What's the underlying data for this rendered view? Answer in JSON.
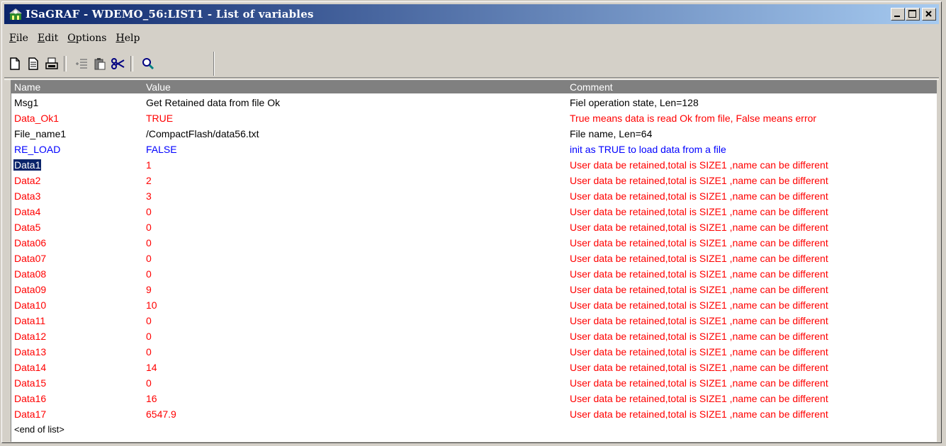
{
  "window": {
    "title": "ISaGRAF - WDEMO_56:LIST1 - List of variables"
  },
  "menu": [
    {
      "u": "F",
      "rest": "ile"
    },
    {
      "u": "E",
      "rest": "dit"
    },
    {
      "u": "O",
      "rest": "ptions"
    },
    {
      "u": "H",
      "rest": "elp"
    }
  ],
  "toolbar": {
    "icons": [
      "new-icon",
      "edit-icon",
      "print-icon",
      "insert-icon",
      "paste-icon",
      "cut-icon",
      "search-icon"
    ]
  },
  "list": {
    "headers": {
      "name": "Name",
      "value": "Value",
      "comment": "Comment"
    },
    "selected_row": 4,
    "rows": [
      {
        "name": "Msg1",
        "value": "Get Retained data from file Ok",
        "comment": "Fiel operation state, Len=128",
        "color": "#000000"
      },
      {
        "name": "Data_Ok1",
        "value": "TRUE",
        "comment": "True means data is read Ok from file, False means error",
        "color": "#ff0000"
      },
      {
        "name": "File_name1",
        "value": "/CompactFlash/data56.txt",
        "comment": "File name, Len=64",
        "color": "#000000"
      },
      {
        "name": "RE_LOAD",
        "value": "FALSE",
        "comment": "init as TRUE to load data from a file",
        "color": "#0000ff"
      },
      {
        "name": "Data1",
        "value": "1",
        "comment": "User data be retained,total is SIZE1 ,name can be different",
        "color": "#ff0000"
      },
      {
        "name": "Data2",
        "value": "2",
        "comment": "User data be retained,total is SIZE1 ,name can be different",
        "color": "#ff0000"
      },
      {
        "name": "Data3",
        "value": "3",
        "comment": "User data be retained,total is SIZE1 ,name can be different",
        "color": "#ff0000"
      },
      {
        "name": "Data4",
        "value": "0",
        "comment": "User data be retained,total is SIZE1 ,name can be different",
        "color": "#ff0000"
      },
      {
        "name": "Data5",
        "value": "0",
        "comment": "User data be retained,total is SIZE1 ,name can be different",
        "color": "#ff0000"
      },
      {
        "name": "Data06",
        "value": "0",
        "comment": "User data be retained,total is SIZE1 ,name can be different",
        "color": "#ff0000"
      },
      {
        "name": "Data07",
        "value": "0",
        "comment": "User data be retained,total is SIZE1 ,name can be different",
        "color": "#ff0000"
      },
      {
        "name": "Data08",
        "value": "0",
        "comment": "User data be retained,total is SIZE1 ,name can be different",
        "color": "#ff0000"
      },
      {
        "name": "Data09",
        "value": "9",
        "comment": "User data be retained,total is SIZE1 ,name can be different",
        "color": "#ff0000"
      },
      {
        "name": "Data10",
        "value": "10",
        "comment": "User data be retained,total is SIZE1 ,name can be different",
        "color": "#ff0000"
      },
      {
        "name": "Data11",
        "value": "0",
        "comment": "User data be retained,total is SIZE1 ,name can be different",
        "color": "#ff0000"
      },
      {
        "name": "Data12",
        "value": "0",
        "comment": "User data be retained,total is SIZE1 ,name can be different",
        "color": "#ff0000"
      },
      {
        "name": "Data13",
        "value": "0",
        "comment": "User data be retained,total is SIZE1 ,name can be different",
        "color": "#ff0000"
      },
      {
        "name": "Data14",
        "value": "14",
        "comment": "User data be retained,total is SIZE1 ,name can be different",
        "color": "#ff0000"
      },
      {
        "name": "Data15",
        "value": "0",
        "comment": "User data be retained,total is SIZE1 ,name can be different",
        "color": "#ff0000"
      },
      {
        "name": "Data16",
        "value": "16",
        "comment": "User data be retained,total is SIZE1 ,name can be different",
        "color": "#ff0000"
      },
      {
        "name": "Data17",
        "value": "6547.9",
        "comment": "User data be retained,total is SIZE1 ,name can be different",
        "color": "#ff0000"
      }
    ],
    "end_label": "<end of list>"
  }
}
